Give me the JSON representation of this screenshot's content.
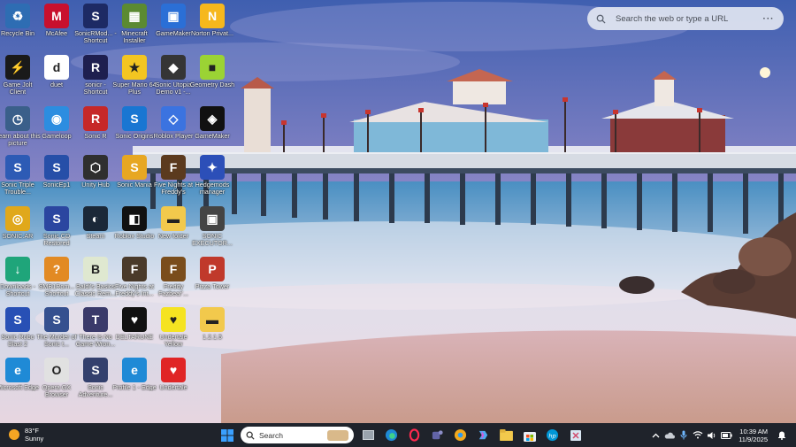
{
  "search_widget": {
    "placeholder": "Search the web or type a URL"
  },
  "desktop_icons": [
    {
      "label": "Recycle Bin",
      "bg": "#2e6db3",
      "glyph": "♻"
    },
    {
      "label": "McAfee",
      "bg": "#c8102e",
      "glyph": "M"
    },
    {
      "label": "SonicRMod... - Shortcut",
      "bg": "#1d2a64",
      "glyph": "S"
    },
    {
      "label": "Minecraft Installer",
      "bg": "#5b8a32",
      "glyph": "▦"
    },
    {
      "label": "GameMaker",
      "bg": "#2b6fd6",
      "glyph": "▣"
    },
    {
      "label": "Norton Privat...",
      "bg": "#f6b81d",
      "glyph": "N"
    },
    {
      "label": "Game Jolt Client",
      "bg": "#1a1a1a",
      "glyph": "⚡"
    },
    {
      "label": "duet",
      "bg": "#ffffff",
      "glyph": "d"
    },
    {
      "label": "sonicr - Shortcut",
      "bg": "#1e1f4f",
      "glyph": "R"
    },
    {
      "label": "Super Mario 64 Plus",
      "bg": "#f3c521",
      "glyph": "★"
    },
    {
      "label": "Sonic Utopia Demo v1 -...",
      "bg": "#353535",
      "glyph": "◆"
    },
    {
      "label": "Geometry Dash",
      "bg": "#9bd334",
      "glyph": "■"
    },
    {
      "label": "Learn about this picture",
      "bg": "#3a5f8a",
      "glyph": "◷"
    },
    {
      "label": "Gameloop",
      "bg": "#2c8de0",
      "glyph": "◉"
    },
    {
      "label": "Sonic R",
      "bg": "#c62828",
      "glyph": "R"
    },
    {
      "label": "Sonic Origins",
      "bg": "#1976d2",
      "glyph": "S"
    },
    {
      "label": "Roblox Player",
      "bg": "#3b73e0",
      "glyph": "◇"
    },
    {
      "label": "GameMaker",
      "bg": "#111111",
      "glyph": "◈"
    },
    {
      "label": "Sonic Triple Trouble...",
      "bg": "#2d5bb5",
      "glyph": "S"
    },
    {
      "label": "SonicEp1",
      "bg": "#264fa8",
      "glyph": "S"
    },
    {
      "label": "Unity Hub",
      "bg": "#2f2f2f",
      "glyph": "⬡"
    },
    {
      "label": "Sonic Mania",
      "bg": "#e7a722",
      "glyph": "S"
    },
    {
      "label": "Five Nights at Freddy's",
      "bg": "#5b3a1e",
      "glyph": "F"
    },
    {
      "label": "Hedgemods manager",
      "bg": "#2c4fb8",
      "glyph": "✦"
    },
    {
      "label": "SONIC.AR",
      "bg": "#e0a81b",
      "glyph": "◎"
    },
    {
      "label": "Sonic CD Restored",
      "bg": "#2b46a0",
      "glyph": "S"
    },
    {
      "label": "Steam",
      "bg": "#1b2838",
      "glyph": "◐"
    },
    {
      "label": "Roblox Studio",
      "bg": "#111111",
      "glyph": "◧"
    },
    {
      "label": "New folder",
      "bg": "#f2c94c",
      "glyph": "▬"
    },
    {
      "label": "SONIC EXECUTOR...",
      "bg": "#444444",
      "glyph": "▣"
    },
    {
      "label": "Downloads - Shortcut",
      "bg": "#1fa57a",
      "glyph": "↓"
    },
    {
      "label": "SMB1Rom... Shortcut",
      "bg": "#e28a23",
      "glyph": "?"
    },
    {
      "label": "Baldi's Basics Classic Rem...",
      "bg": "#dfe8d0",
      "glyph": "B"
    },
    {
      "label": "Five Nights at Freddy's Int...",
      "bg": "#4a3a2a",
      "glyph": "F"
    },
    {
      "label": "Freddy Fazbear'...",
      "bg": "#7a4d1c",
      "glyph": "F"
    },
    {
      "label": "Pizza Tower",
      "bg": "#c0392b",
      "glyph": "P"
    },
    {
      "label": "Sonic Robo Blast 2",
      "bg": "#2850b5",
      "glyph": "S"
    },
    {
      "label": "The Murder of Sonic t...",
      "bg": "#35508f",
      "glyph": "S"
    },
    {
      "label": "There Is No Game Wron...",
      "bg": "#3a3a6a",
      "glyph": "T"
    },
    {
      "label": "DELTARUNE",
      "bg": "#111111",
      "glyph": "♥"
    },
    {
      "label": "Undertale Yellow",
      "bg": "#f5e321",
      "glyph": "♥"
    },
    {
      "label": "1.2.1.5",
      "bg": "#f2c94c",
      "glyph": "▬"
    },
    {
      "label": "Microsoft Edge",
      "bg": "#1f8ad6",
      "glyph": "e"
    },
    {
      "label": "Opera GX Browser",
      "bg": "#e1e1e1",
      "glyph": "O"
    },
    {
      "label": "Sonic Adventure...",
      "bg": "#33406d",
      "glyph": "S"
    },
    {
      "label": "Profile 1 - Edge",
      "bg": "#1f8ad6",
      "glyph": "e"
    },
    {
      "label": "Undertale",
      "bg": "#e02525",
      "glyph": "♥"
    }
  ],
  "taskbar": {
    "weather_temp": "83°F",
    "weather_cond": "Sunny",
    "search_placeholder": "Search",
    "time": "10:39 AM",
    "date": "11/9/2025"
  }
}
